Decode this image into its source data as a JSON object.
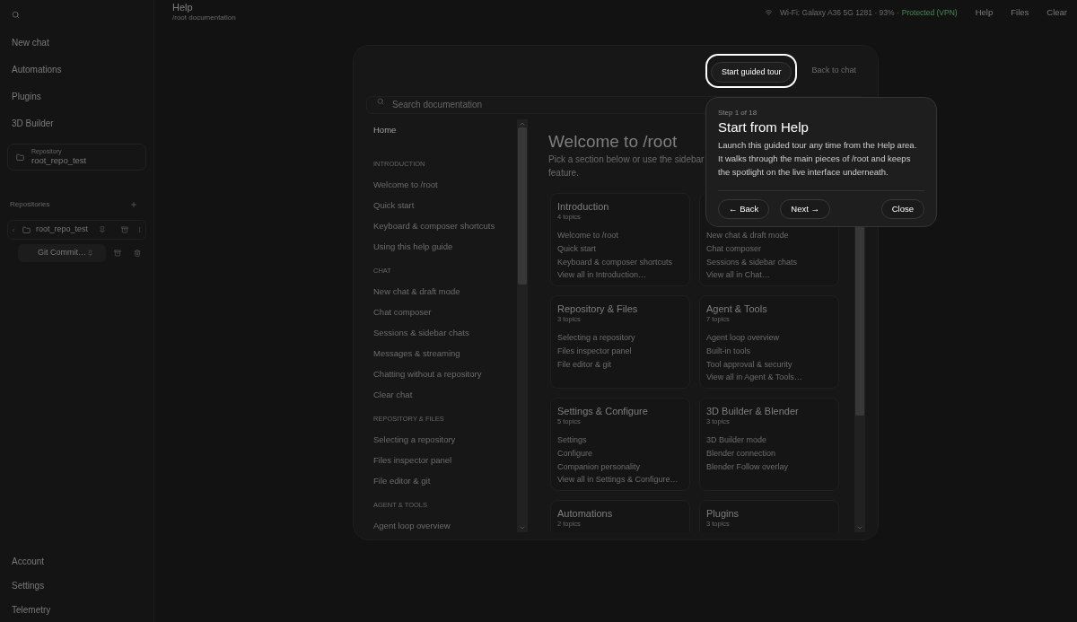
{
  "sidebar": {
    "nav": [
      "New chat",
      "Automations",
      "Plugins",
      "3D Builder"
    ],
    "repository_card": {
      "label": "Repository",
      "value": "root_repo_test"
    },
    "repositories": {
      "title": "Repositories",
      "items": [
        {
          "name": "root_repo_test",
          "children": [
            {
              "name": "Git Commit…",
              "selected": true
            }
          ]
        }
      ]
    },
    "footer": [
      "Account",
      "Settings",
      "Telemetry"
    ]
  },
  "header": {
    "title": "Help",
    "subtitle": "/root documentation",
    "wifi": "Wi-Fi: Galaxy A36 5G 1281 · 93% ·",
    "vpn": "Protected (VPN)",
    "actions": [
      "Help",
      "Files",
      "Clear"
    ]
  },
  "help": {
    "tour_button": {
      "label": "Start guided tour",
      "spotlight": true
    },
    "back_button": "Back to chat",
    "search": {
      "placeholder": "Search documentation"
    },
    "nav": {
      "top": [
        {
          "label": "Home",
          "selected": true
        }
      ],
      "sections": [
        {
          "title": "INTRODUCTION",
          "items": [
            {
              "label": "Welcome to /root",
              "selected": false
            },
            {
              "label": "Quick start",
              "selected": false
            },
            {
              "label": "Keyboard & composer shortcuts",
              "selected": false
            },
            {
              "label": "Using this help guide",
              "selected": false
            }
          ]
        },
        {
          "title": "CHAT",
          "items": [
            {
              "label": "New chat & draft mode",
              "selected": false
            },
            {
              "label": "Chat composer",
              "selected": false
            },
            {
              "label": "Sessions & sidebar chats",
              "selected": false
            },
            {
              "label": "Messages & streaming",
              "selected": false
            },
            {
              "label": "Chatting without a repository",
              "selected": false
            },
            {
              "label": "Clear chat",
              "selected": false
            }
          ]
        },
        {
          "title": "REPOSITORY & FILES",
          "items": [
            {
              "label": "Selecting a repository",
              "selected": false
            },
            {
              "label": "Files inspector panel",
              "selected": false
            },
            {
              "label": "File editor & git",
              "selected": false
            }
          ]
        },
        {
          "title": "AGENT & TOOLS",
          "items": [
            {
              "label": "Agent loop overview",
              "selected": false
            }
          ]
        }
      ]
    },
    "content": {
      "title": "Welcome to /root",
      "description_lines": [
        "Pick a section below or use the sidebar",
        "feature."
      ],
      "cards": [
        {
          "title": "Introduction",
          "count": "4 topics",
          "links": [
            "Welcome to /root",
            "Quick start",
            "Keyboard & composer shortcuts",
            "View all in Introduction…"
          ]
        },
        {
          "links": [
            "New chat & draft mode",
            "Chat composer",
            "Sessions & sidebar chats",
            "View all in Chat…"
          ]
        },
        {
          "title": "Repository & Files",
          "count": "3 topics",
          "links": [
            "Selecting a repository",
            "Files inspector panel",
            "File editor & git"
          ]
        },
        {
          "title": "Agent & Tools",
          "count": "7 topics",
          "links": [
            "Agent loop overview",
            "Built-in tools",
            "Tool approval & security",
            "View all in Agent & Tools…"
          ]
        },
        {
          "title": "Settings & Configure",
          "count": "5 topics",
          "links": [
            "Settings",
            "Configure",
            "Companion personality",
            "View all in Settings & Configure…"
          ]
        },
        {
          "title": "3D Builder & Blender",
          "count": "3 topics",
          "links": [
            "3D Builder mode",
            "Blender connection",
            "Blender Follow overlay"
          ]
        },
        {
          "title": "Automations",
          "count": "2 topics"
        },
        {
          "title": "Plugins",
          "count": "3 topics"
        }
      ]
    }
  },
  "tour_popover": {
    "step": "Step 1 of 18",
    "title": "Start from Help",
    "body": "Launch this guided tour any time from the Help area. It walks through the main pieces of /root and keeps the spotlight on the live interface underneath.",
    "buttons": [
      {
        "kind": "back",
        "label": "← Back"
      },
      {
        "kind": "next",
        "label": "Next →"
      },
      {
        "kind": "close",
        "label": "Close"
      }
    ]
  }
}
